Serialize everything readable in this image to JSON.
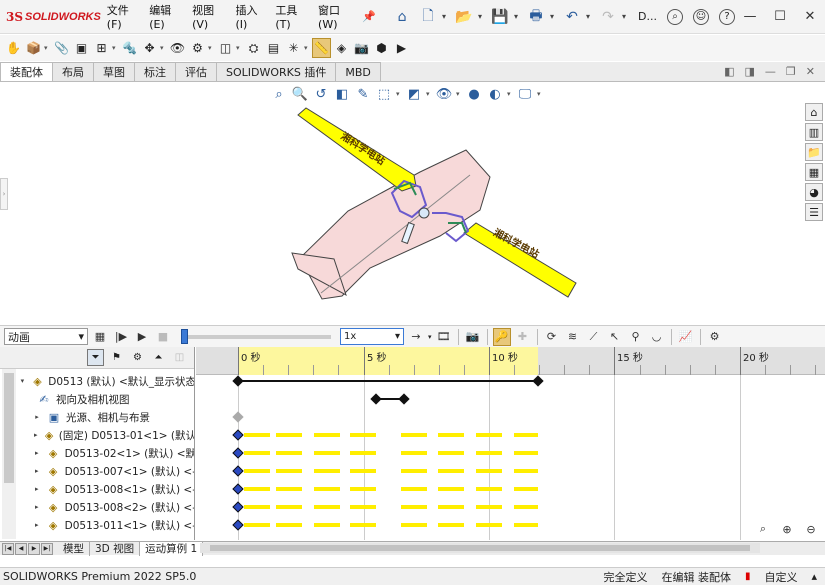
{
  "app": {
    "logo_ds": "3S",
    "logo_brand": "SOLIDWORKS",
    "user_initial": "D..."
  },
  "menu": [
    "文件(F)",
    "编辑(E)",
    "视图(V)",
    "插入(I)",
    "工具(T)",
    "窗口(W)"
  ],
  "command_tabs": [
    "装配体",
    "布局",
    "草图",
    "标注",
    "评估",
    "SOLIDWORKS 插件",
    "MBD"
  ],
  "active_command_tab": "装配体",
  "motion": {
    "study_type": "动画",
    "playback_speed": "1x",
    "timeline_labels": [
      "0 秒",
      "5 秒",
      "10 秒",
      "15 秒",
      "20 秒"
    ]
  },
  "tree": {
    "root": "D0513 (默认) <默认_显示状态",
    "items": [
      "视向及相机视图",
      "光源、相机与布景",
      "(固定) D0513-01<1> (默认",
      "D0513-02<1> (默认) <默",
      "D0513-007<1> (默认) <-",
      "D0513-008<1> (默认) <-",
      "D0513-008<2> (默认) <-",
      "D0513-011<1> (默认) <-"
    ]
  },
  "bottom_tabs": [
    "模型",
    "3D 视图",
    "运动算例 1"
  ],
  "active_bottom_tab": "运动算例 1",
  "status": {
    "product": "SOLIDWORKS Premium 2022 SP5.0",
    "constraint": "完全定义",
    "mode": "在编辑 装配体",
    "units": "自定义"
  },
  "plane": {
    "wing_text": "湘科学电站"
  },
  "colors": {
    "wing": "#ffff00",
    "fuselage": "#f7d9d9",
    "key_blue": "#2b4ac2",
    "bar_yellow": "#ffee00",
    "brand_red": "#d0181f"
  }
}
